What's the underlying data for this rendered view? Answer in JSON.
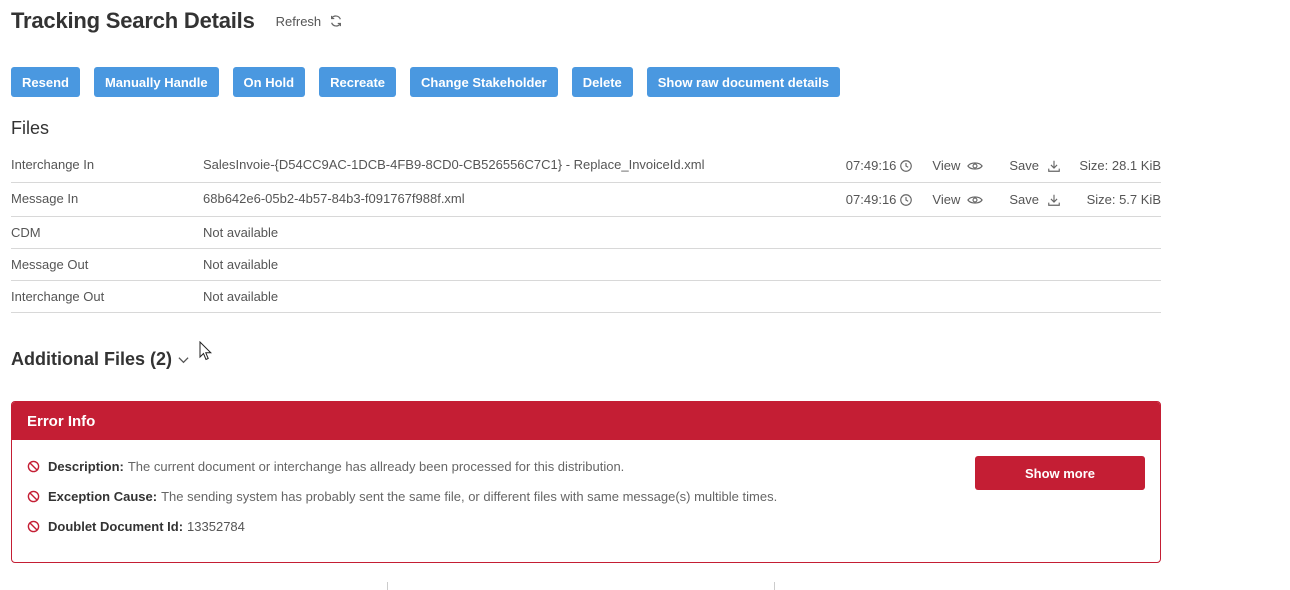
{
  "header": {
    "title": "Tracking Search Details",
    "refresh_label": "Refresh"
  },
  "actions": [
    "Resend",
    "Manually Handle",
    "On Hold",
    "Recreate",
    "Change Stakeholder",
    "Delete",
    "Show raw document details"
  ],
  "files": {
    "title": "Files",
    "rows": [
      {
        "label": "Interchange In",
        "value": "SalesInvoie-{D54CC9AC-1DCB-4FB9-8CD0-CB526556C7C1} - Replace_InvoiceId.xml",
        "time": "07:49:16",
        "view": "View",
        "save": "Save",
        "size": "Size: 28.1 KiB"
      },
      {
        "label": "Message In",
        "value": "68b642e6-05b2-4b57-84b3-f091767f988f.xml",
        "time": "07:49:16",
        "view": "View",
        "save": "Save",
        "size": "Size: 5.7 KiB"
      },
      {
        "label": "CDM",
        "value": "Not available"
      },
      {
        "label": "Message Out",
        "value": "Not available"
      },
      {
        "label": "Interchange Out",
        "value": "Not available"
      }
    ]
  },
  "additional_files": {
    "title": "Additional Files (2)"
  },
  "error_info": {
    "title": "Error Info",
    "items": [
      {
        "key": "Description:",
        "value": "The current document or interchange has allready been processed for this distribution."
      },
      {
        "key": "Exception Cause:",
        "value": "The sending system has probably sent the same file, or different files with same message(s) multible times."
      },
      {
        "key": "Doublet Document Id:",
        "value": "13352784"
      }
    ],
    "show_more_label": "Show more"
  },
  "colors": {
    "primary_button": "#4a98e0",
    "error": "#c41e34"
  },
  "icons": {
    "refresh": "refresh-icon",
    "clock": "clock-icon",
    "view": "eye-icon",
    "save": "download-icon",
    "chevron": "chevron-down-icon",
    "error": "prohibited-icon"
  }
}
